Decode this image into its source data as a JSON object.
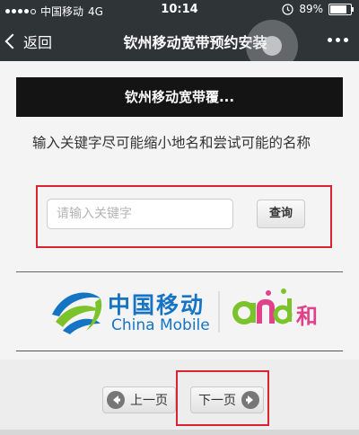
{
  "status_bar": {
    "carrier": "中国移动",
    "network": "4G",
    "time": "10:14",
    "battery_text": "89%",
    "battery_level": 0.89,
    "signal_bars": 4
  },
  "nav": {
    "back_label": "返回",
    "title": "钦州移动宽带预约安装",
    "more_icon": "more-dots-icon"
  },
  "banner": {
    "text": "钦州移动宽带覆..."
  },
  "instructions": "输入关键字尽可能缩小地名和尝试可能的名称",
  "search": {
    "placeholder": "请输入关键字",
    "value": "",
    "button_label": "查询"
  },
  "logo": {
    "cn_name": "中国移动",
    "en_name": "China Mobile",
    "brand_and": "and",
    "brand_he": "和"
  },
  "pager": {
    "prev_label": "上一页",
    "next_label": "下一页"
  },
  "colors": {
    "header_bg": "#2f3437",
    "banner_bg": "#141414",
    "highlight": "#d9232e",
    "cmcc_blue": "#1574c4",
    "cmcc_green": "#7cc22b",
    "and_pink": "#e0418a"
  }
}
